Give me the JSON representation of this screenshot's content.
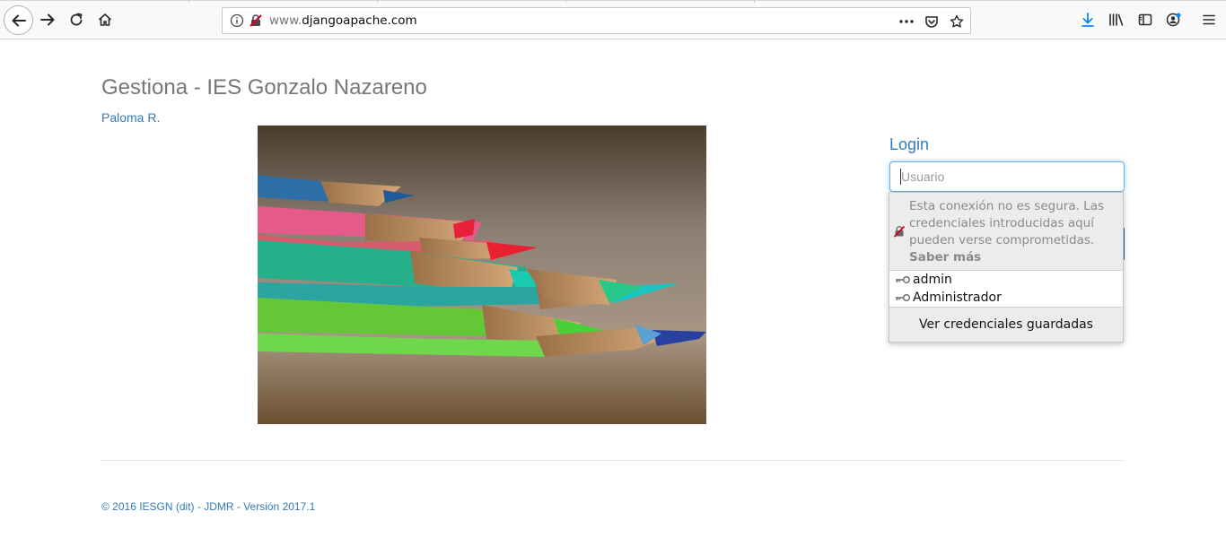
{
  "browser": {
    "url_prefix": "www.",
    "url_domain": "djangoapache.com",
    "accent": "#0a84ff"
  },
  "page": {
    "title": "Gestiona - IES Gonzalo Nazareno",
    "user_link": "Paloma R.",
    "link_color": "#337ab7"
  },
  "login": {
    "title": "Login",
    "username_placeholder": "Usuario"
  },
  "autocomplete": {
    "warning_text": "Esta conexión no es segura. Las credenciales introducidas aquí pueden verse comprometidas.",
    "learn_more": "Saber más",
    "credentials": [
      {
        "label": "admin"
      },
      {
        "label": "Administrador"
      }
    ],
    "view_saved": "Ver credenciales guardadas"
  },
  "footer": {
    "copyright": "© 2016 IESGN (dit) - JDMR - Versión 2017.1"
  }
}
